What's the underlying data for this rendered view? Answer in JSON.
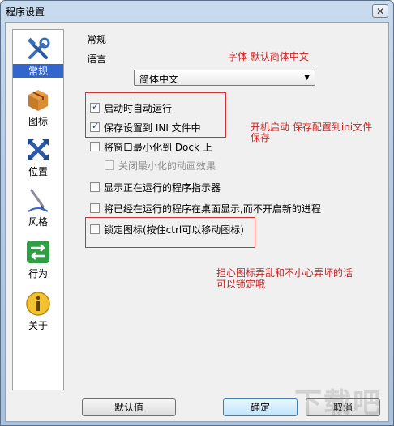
{
  "window": {
    "title": "程序设置",
    "close_symbol": "✕"
  },
  "sidebar": {
    "items": [
      {
        "label": "常规",
        "icon": "tools-icon",
        "selected": true
      },
      {
        "label": "图标",
        "icon": "box-icon",
        "selected": false
      },
      {
        "label": "位置",
        "icon": "move-arrows-icon",
        "selected": false
      },
      {
        "label": "风格",
        "icon": "brush-icon",
        "selected": false
      },
      {
        "label": "行为",
        "icon": "switch-arrows-icon",
        "selected": false
      },
      {
        "label": "关于",
        "icon": "info-icon",
        "selected": false
      }
    ]
  },
  "general": {
    "section_title": "常规",
    "language_label": "语言",
    "language_selected": "简体中文",
    "options": [
      {
        "label": "启动时自动运行",
        "checked": true,
        "enabled": true
      },
      {
        "label": "保存设置到 INI 文件中",
        "checked": true,
        "enabled": true
      },
      {
        "label": "将窗口最小化到 Dock 上",
        "checked": false,
        "enabled": true
      },
      {
        "label": "关闭最小化的动画效果",
        "checked": false,
        "enabled": false
      },
      {
        "label": "显示正在运行的程序指示器",
        "checked": false,
        "enabled": true
      },
      {
        "label": "将已经在运行的程序在桌面显示,而不开启新的进程",
        "checked": false,
        "enabled": true
      },
      {
        "label": "锁定图标(按住ctrl可以移动图标)",
        "checked": false,
        "enabled": true
      }
    ]
  },
  "annotations": {
    "font_note": "字体  默认简体中文",
    "startup_note_line1": "开机启动  保存配置到ini文件",
    "startup_note_line2": "保存",
    "lock_note_line1": "担心图标弄乱和不小心弄坏的话",
    "lock_note_line2": "可以锁定哦"
  },
  "buttons": {
    "default": "默认值",
    "ok": "确定",
    "cancel": "取消"
  },
  "watermark": "下载吧",
  "colors": {
    "annotation_red": "#d02020",
    "selection_blue": "#3366cc"
  }
}
